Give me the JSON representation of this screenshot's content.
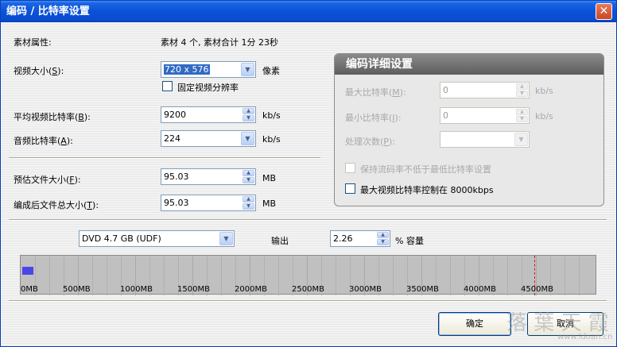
{
  "window": {
    "title": "编码 / 比特率设置",
    "close_label": "✕"
  },
  "material": {
    "label": "素材属性:",
    "value": "素材 4 个, 素材合计 1分 23秒"
  },
  "video_size": {
    "label_pre": "视频大小(",
    "label_key": "S",
    "label_post": "):",
    "value": "720 x 576",
    "unit": "像素"
  },
  "fixed_res": {
    "label": "固定视频分辨率",
    "checked": false
  },
  "avg_bitrate": {
    "label_pre": "平均视频比特率(",
    "label_key": "B",
    "label_post": "):",
    "value": "9200",
    "unit": "kb/s"
  },
  "audio_bitrate": {
    "label_pre": "音频比特率(",
    "label_key": "A",
    "label_post": "):",
    "value": "224",
    "unit": "kb/s"
  },
  "est_size": {
    "label_pre": "预估文件大小(",
    "label_key": "F",
    "label_post": "):",
    "value": "95.03",
    "unit": "MB"
  },
  "total_size": {
    "label_pre": "编成后文件总大小(",
    "label_key": "T",
    "label_post": "):",
    "value": "95.03",
    "unit": "MB"
  },
  "advanced": {
    "title": "编码详细设置",
    "max_bitrate": {
      "label_pre": "最大比特率(",
      "label_key": "M",
      "label_post": "):",
      "value": "0",
      "unit": "kb/s"
    },
    "min_bitrate": {
      "label_pre": "最小比特率(",
      "label_key": "I",
      "label_post": "):",
      "value": "0",
      "unit": "kb/s"
    },
    "passes": {
      "label_pre": "处理次数(",
      "label_key": "P",
      "label_post": "):",
      "value": ""
    },
    "keep_min": {
      "label": "保持流码率不低于最低比特率设置",
      "checked": false
    },
    "max_video": {
      "label": "最大视频比特率控制在 8000kbps",
      "checked": false
    }
  },
  "disc": {
    "value": "DVD 4.7 GB (UDF)",
    "output_label": "输出",
    "output_value": "2.26",
    "unit": "% 容量"
  },
  "capacity_bar": {
    "used_mb": 95.03,
    "max_mb": 5000,
    "dvd_limit_mb": 4488,
    "labels": [
      "0MB",
      "500MB",
      "1000MB",
      "1500MB",
      "2000MB",
      "2500MB",
      "3000MB",
      "3500MB",
      "4000MB",
      "4500MB"
    ]
  },
  "buttons": {
    "ok": "确定",
    "cancel": "取消"
  },
  "watermark": {
    "text": "落 葉 天 霞",
    "url": "www.ldoan.cn"
  },
  "colors": {
    "title_bar": "#0a52d8",
    "bar_fill": "#4a46ea",
    "dvd_limit": "#e01010"
  }
}
